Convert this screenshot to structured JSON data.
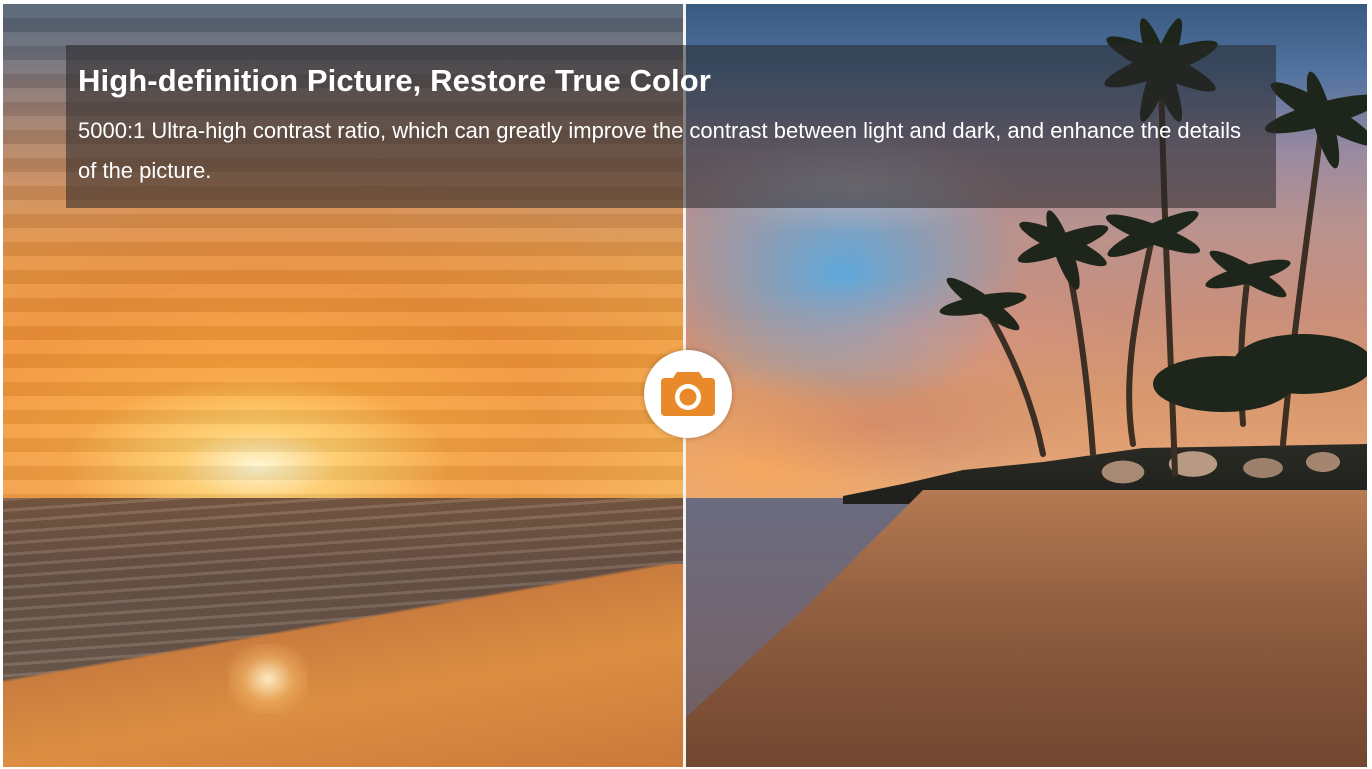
{
  "feature": {
    "title": "High-definition Picture, Restore True Color",
    "description": "5000:1 Ultra-high contrast ratio, which can greatly improve the contrast between light and dark, and enhance the details of the picture."
  },
  "comparison": {
    "left_image": "sunset-beach-before",
    "right_image": "sunset-beach-after",
    "split_position_fraction": 0.5,
    "handle_icon": "camera-icon"
  },
  "colors": {
    "accent": "#e98a2a",
    "divider": "#f4f1ee",
    "caption_bg": "#28262899"
  }
}
